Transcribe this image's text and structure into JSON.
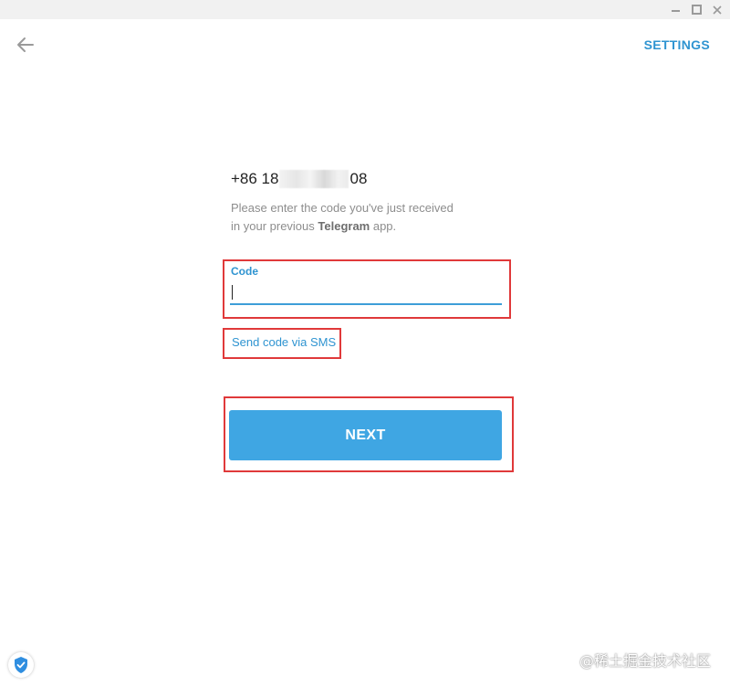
{
  "window": {
    "controls": [
      "minimize",
      "maximize",
      "close"
    ]
  },
  "header": {
    "back_icon": "arrow-left-icon",
    "settings_label": "SETTINGS"
  },
  "login": {
    "phone_prefix": "+86 18",
    "phone_suffix": "08",
    "hint_line1": "Please enter the code you've just received",
    "hint_line2_before": "in your previous ",
    "hint_line2_bold": "Telegram",
    "hint_line2_after": " app.",
    "code_label": "Code",
    "code_value": "",
    "send_sms_label": "Send code via SMS",
    "next_label": "NEXT"
  },
  "footer": {
    "badge_icon": "shield-check-icon",
    "watermark": "@稀土掘金技术社区"
  },
  "colors": {
    "accent": "#2f94d1",
    "button": "#3fa6e3",
    "highlight_box": "#e0393a"
  }
}
